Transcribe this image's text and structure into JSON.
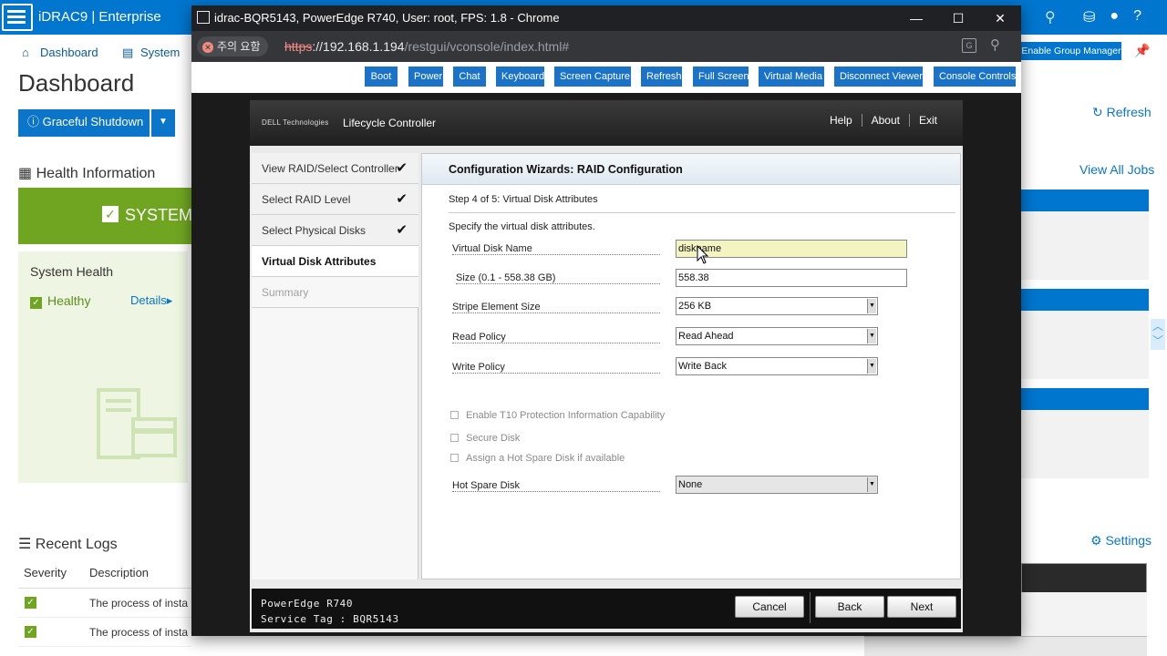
{
  "background": {
    "brand": "iDRAC9 | Enterprise",
    "nav": {
      "dashboard": "Dashboard",
      "system": "System"
    },
    "enable_group_manager": "Enable Group Manager",
    "page_title": "Dashboard",
    "graceful_shutdown": "Graceful Shutdown",
    "refresh": "Refresh",
    "health_information": "Health Information",
    "view_all_jobs": "View All Jobs",
    "system_status": "SYSTEM",
    "system_health": "System Health",
    "healthy": "Healthy",
    "details": "Details",
    "recent_logs": "Recent Logs",
    "settings": "Settings",
    "logs_columns": [
      "Severity",
      "Description"
    ],
    "log_rows": [
      "The process of insta",
      "The process of insta"
    ]
  },
  "chrome": {
    "title": "idrac-BQR5143, PowerEdge R740, User: root, FPS: 1.8 - Chrome",
    "security_label": "주의 요함",
    "url_scheme": "https",
    "url_host": "://192.168.1.194",
    "url_path": "/restgui/vconsole/index.html#",
    "minimize": "—",
    "maximize": "☐",
    "close": "✕"
  },
  "viewer_toolbar": [
    "Boot",
    "Power",
    "Chat",
    "Keyboard",
    "Screen Capture",
    "Refresh",
    "Full Screen",
    "Virtual Media",
    "Disconnect Viewer",
    "Console Controls"
  ],
  "lifecycle": {
    "vendor": "DELL Technologies",
    "product": "Lifecycle Controller",
    "menu": [
      "Help",
      "About",
      "Exit"
    ],
    "steps": [
      {
        "label": "View RAID/Select Controller",
        "check": "✔"
      },
      {
        "label": "Select RAID Level",
        "check": "✔"
      },
      {
        "label": "Select Physical Disks",
        "check": "✔"
      },
      {
        "label": "Virtual Disk Attributes",
        "check": ""
      },
      {
        "label": "Summary",
        "check": ""
      }
    ],
    "main_title": "Configuration Wizards: RAID Configuration",
    "step_text": "Step 4 of 5: Virtual Disk Attributes",
    "instruction": "Specify the virtual disk attributes.",
    "fields": {
      "vd_name_label": "Virtual Disk Name",
      "vd_name_value": "diskname",
      "size_label": "Size (0.1 - 558.38 GB)",
      "size_value": "558.38",
      "stripe_label": "Stripe Element Size",
      "stripe_value": "256 KB",
      "read_label": "Read Policy",
      "read_value": "Read Ahead",
      "write_label": "Write Policy",
      "write_value": "Write Back",
      "t10_label": "Enable T10 Protection Information Capability",
      "secure_label": "Secure Disk",
      "hotspare_assign_label": "Assign a Hot Spare Disk if available",
      "hotspare_disk_label": "Hot Spare Disk",
      "hotspare_disk_value": "None"
    },
    "footer": {
      "model": "PowerEdge R740",
      "service_tag": "Service Tag : BQR5143",
      "cancel": "Cancel",
      "back": "Back",
      "next": "Next"
    }
  },
  "colors": {
    "idrac_blue": "#0076ce",
    "health_green": "#6fa521",
    "toolbar_button": "#1a73c8",
    "active_field": "#f3f4c1"
  }
}
